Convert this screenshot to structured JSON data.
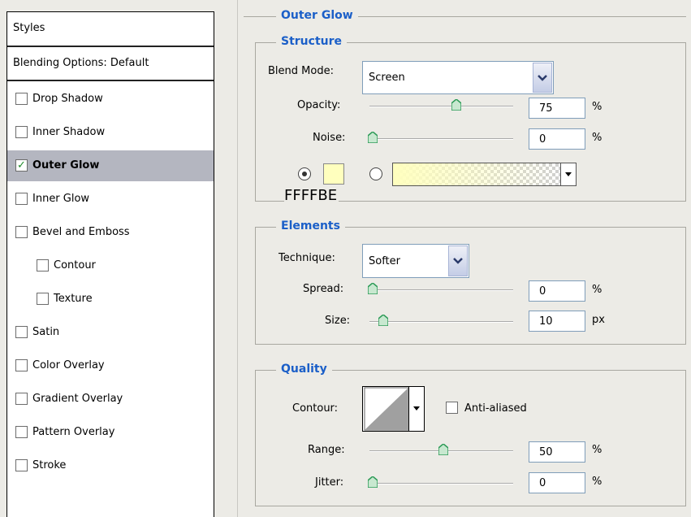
{
  "styles_panel": {
    "header": "Styles",
    "blending_options": "Blending Options: Default",
    "items": [
      {
        "label": "Drop Shadow",
        "checked": false,
        "selected": false,
        "indent": false
      },
      {
        "label": "Inner Shadow",
        "checked": false,
        "selected": false,
        "indent": false
      },
      {
        "label": "Outer Glow",
        "checked": true,
        "selected": true,
        "indent": false
      },
      {
        "label": "Inner Glow",
        "checked": false,
        "selected": false,
        "indent": false
      },
      {
        "label": "Bevel and Emboss",
        "checked": false,
        "selected": false,
        "indent": false
      },
      {
        "label": "Contour",
        "checked": false,
        "selected": false,
        "indent": true
      },
      {
        "label": "Texture",
        "checked": false,
        "selected": false,
        "indent": true
      },
      {
        "label": "Satin",
        "checked": false,
        "selected": false,
        "indent": false
      },
      {
        "label": "Color Overlay",
        "checked": false,
        "selected": false,
        "indent": false
      },
      {
        "label": "Gradient Overlay",
        "checked": false,
        "selected": false,
        "indent": false
      },
      {
        "label": "Pattern Overlay",
        "checked": false,
        "selected": false,
        "indent": false
      },
      {
        "label": "Stroke",
        "checked": false,
        "selected": false,
        "indent": false
      }
    ]
  },
  "outer_glow": {
    "title": "Outer Glow",
    "structure": {
      "title": "Structure",
      "blend_mode_label": "Blend Mode:",
      "blend_mode_value": "Screen",
      "opacity_label": "Opacity:",
      "opacity_value": "75",
      "opacity_unit": "%",
      "opacity_level": 0.75,
      "noise_label": "Noise:",
      "noise_value": "0",
      "noise_unit": "%",
      "noise_level": 0,
      "color_swatch": "#FFFFBE",
      "color_caption": "FFFFBE",
      "color_radio_selected": true
    },
    "elements": {
      "title": "Elements",
      "technique_label": "Technique:",
      "technique_value": "Softer",
      "spread_label": "Spread:",
      "spread_value": "0",
      "spread_unit": "%",
      "spread_level": 0,
      "size_label": "Size:",
      "size_value": "10",
      "size_unit": "px"
    },
    "quality": {
      "title": "Quality",
      "contour_label": "Contour:",
      "anti_aliased_label": "Anti-aliased",
      "anti_aliased_checked": false,
      "range_label": "Range:",
      "range_value": "50",
      "range_unit": "%",
      "range_level": 0.5,
      "jitter_label": "Jitter:",
      "jitter_value": "0",
      "jitter_unit": "%",
      "jitter_level": 0
    }
  },
  "colors": {
    "title_blue": "#1b5fc8",
    "selected_row": "#b4b6c0",
    "check_green": "#1f8a2a",
    "thumb_green": "#2e9b58"
  }
}
